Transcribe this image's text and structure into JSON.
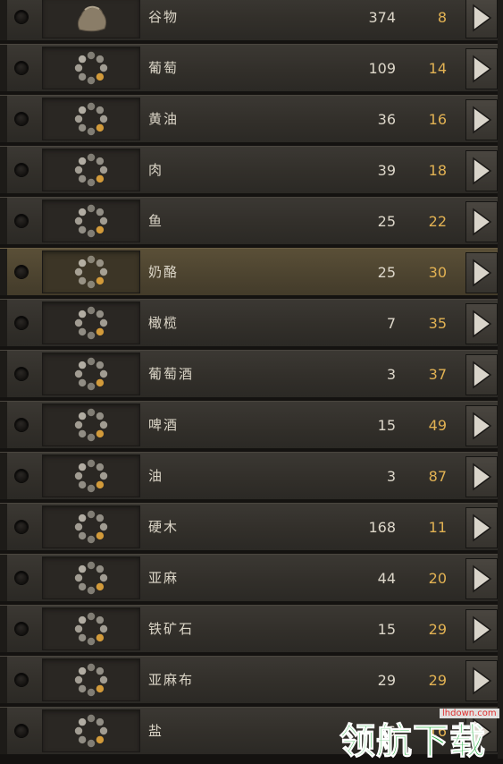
{
  "rows": [
    {
      "name": "谷物",
      "qty": "374",
      "price": "8",
      "icon": "grain-sack-icon",
      "highlight": false
    },
    {
      "name": "葡萄",
      "qty": "109",
      "price": "14",
      "icon": "loading-spinner-icon",
      "highlight": false
    },
    {
      "name": "黄油",
      "qty": "36",
      "price": "16",
      "icon": "loading-spinner-icon",
      "highlight": false
    },
    {
      "name": "肉",
      "qty": "39",
      "price": "18",
      "icon": "loading-spinner-icon",
      "highlight": false
    },
    {
      "name": "鱼",
      "qty": "25",
      "price": "22",
      "icon": "loading-spinner-icon",
      "highlight": false
    },
    {
      "name": "奶酪",
      "qty": "25",
      "price": "30",
      "icon": "loading-spinner-icon",
      "highlight": true
    },
    {
      "name": "橄榄",
      "qty": "7",
      "price": "35",
      "icon": "loading-spinner-icon",
      "highlight": false
    },
    {
      "name": "葡萄酒",
      "qty": "3",
      "price": "37",
      "icon": "loading-spinner-icon",
      "highlight": false
    },
    {
      "name": "啤酒",
      "qty": "15",
      "price": "49",
      "icon": "loading-spinner-icon",
      "highlight": false
    },
    {
      "name": "油",
      "qty": "3",
      "price": "87",
      "icon": "loading-spinner-icon",
      "highlight": false
    },
    {
      "name": "硬木",
      "qty": "168",
      "price": "11",
      "icon": "loading-spinner-icon",
      "highlight": false
    },
    {
      "name": "亚麻",
      "qty": "44",
      "price": "20",
      "icon": "loading-spinner-icon",
      "highlight": false
    },
    {
      "name": "铁矿石",
      "qty": "15",
      "price": "29",
      "icon": "loading-spinner-icon",
      "highlight": false
    },
    {
      "name": "亚麻布",
      "qty": "29",
      "price": "29",
      "icon": "loading-spinner-icon",
      "highlight": false
    },
    {
      "name": "盐",
      "qty": "6",
      "price": "16",
      "icon": "loading-spinner-icon",
      "highlight": false
    }
  ],
  "watermark": {
    "text": "领航下载",
    "url": "lhdown.com"
  },
  "colors": {
    "price": "#e2b253",
    "text": "#dcd6c8",
    "spinner_accent": "#d29a3a",
    "spinner_dot": "#c9c4b8"
  }
}
